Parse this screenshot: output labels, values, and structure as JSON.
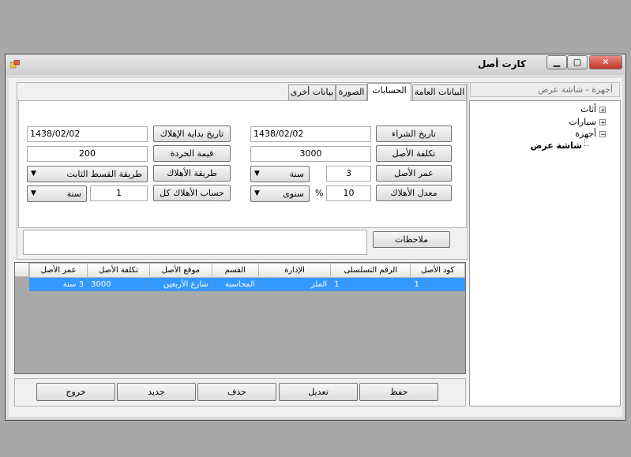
{
  "window": {
    "title": "كارت أصل"
  },
  "tabs": [
    {
      "label": "البيانات العامة",
      "active": false
    },
    {
      "label": "الحسابات",
      "active": true
    },
    {
      "label": "الصورة",
      "active": false
    },
    {
      "label": "بيانات أخرى",
      "active": false
    }
  ],
  "form": {
    "purchase_date_label": "تاريخ الشراء",
    "purchase_date": "1438/02/02",
    "cost_label": "تكلفة الأصل",
    "cost": "3000",
    "age_label": "عمر الأصل",
    "age": "3",
    "age_unit": "سنة",
    "dep_rate_label": "معدل الأهلاك",
    "dep_rate": "10",
    "percent": "%",
    "dep_period": "سنوى",
    "dep_start_label": "تاريخ بداية الإهلاك",
    "dep_start": "1438/02/02",
    "scrap_label": "قيمة الخردة",
    "scrap": "200",
    "dep_method_label": "طريقة الأهلاك",
    "dep_method": "طريقة القسط الثابت",
    "dep_calc_label": "حساب الأهلاك كل",
    "dep_calc": "1",
    "dep_calc_unit": "سنة",
    "notes_label": "ملاحظات",
    "notes": ""
  },
  "grid": {
    "columns": [
      "كود الأصل",
      "الرقم التسلسلى",
      "الإدارة",
      "القسم",
      "موقع الأصل",
      "تكلفة الأصل",
      "عمر الأصل"
    ],
    "rows": [
      [
        "1",
        "1",
        "الملز",
        "المحاسبة",
        "شارع الأربعين",
        "3000",
        "3 سنة"
      ]
    ]
  },
  "buttons": {
    "save": "حفظ",
    "edit": "تعديل",
    "delete": "حذف",
    "new": "جديد",
    "exit": "خروج"
  },
  "tree": {
    "header": "أجهزة - شاشة عرض",
    "nodes": [
      {
        "label": "أثاث",
        "expander": "+"
      },
      {
        "label": "سيارات",
        "expander": "+"
      },
      {
        "label": "أجهزة",
        "expander": "−"
      },
      {
        "label": "شاشة عرض",
        "expander": ""
      }
    ]
  },
  "colors": {
    "selection": "#3399ff",
    "close": "#c3352a"
  }
}
